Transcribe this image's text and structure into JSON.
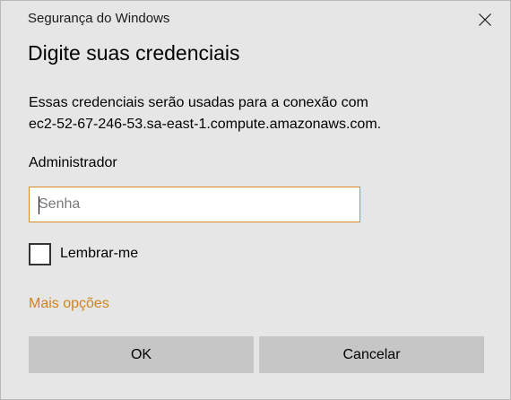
{
  "window": {
    "title": "Segurança do Windows",
    "close_icon": "close-icon"
  },
  "dialog": {
    "heading": "Digite suas credenciais",
    "description_line1": "Essas credenciais serão usadas para a conexão com",
    "description_line2": "ec2-52-67-246-53.sa-east-1.compute.amazonaws.com.",
    "username": "Administrador",
    "password": {
      "value": "",
      "placeholder": "Senha"
    },
    "remember": {
      "label": "Lembrar-me",
      "checked": false
    },
    "more_options_label": "Mais opções",
    "ok_label": "OK",
    "cancel_label": "Cancelar"
  },
  "colors": {
    "background": "#e6e6e6",
    "accent": "#d0841c",
    "button": "#c6c6c6",
    "field_border": "#d98a2a"
  }
}
